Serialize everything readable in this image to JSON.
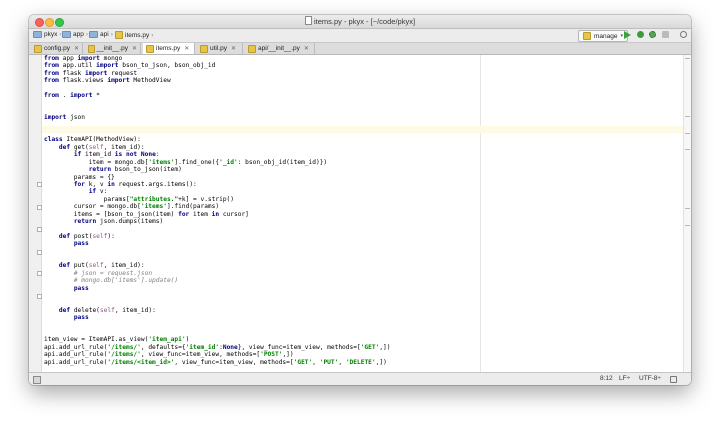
{
  "window": {
    "title": "items.py - pkyx - [~/code/pkyx]"
  },
  "breadcrumb": [
    "pkyx",
    "app",
    "api",
    "items.py"
  ],
  "toolbar": {
    "run_config": "manage"
  },
  "tabs": [
    {
      "label": "config.py",
      "active": false
    },
    {
      "label": "__init__.py",
      "active": false
    },
    {
      "label": "items.py",
      "active": true
    },
    {
      "label": "util.py",
      "active": false
    },
    {
      "label": "api/__init__.py",
      "active": false
    }
  ],
  "editor": {
    "lines": [
      "from app import mongo",
      "from app.util import bson_to_json, bson_obj_id",
      "from flask import request",
      "from flask.views import MethodView",
      "",
      "from . import *",
      "",
      "",
      "import json",
      "",
      "",
      "class ItemAPI(MethodView):",
      "    def get(self, item_id):",
      "        if item_id is not None:",
      "            item = mongo.db['items'].find_one({'_id': bson_obj_id(item_id)})",
      "            return bson_to_json(item)",
      "        params = {}",
      "        for k, v in request.args.items():",
      "            if v:",
      "                params[\"attributes.\"+k] = v.strip()",
      "        cursor = mongo.db['items'].find(params)",
      "        items = [bson_to_json(item) for item in cursor]",
      "        return json.dumps(items)",
      "",
      "    def post(self):",
      "        pass",
      "",
      "",
      "    def put(self, item_id):",
      "        # json = request.json",
      "        # mongo.db['items'].update()",
      "        pass",
      "",
      "",
      "    def delete(self, item_id):",
      "        pass",
      "",
      "",
      "item_view = ItemAPI.as_view('item_api')",
      "api.add_url_rule('/items/', defaults={'item_id':None}, view_func=item_view, methods=['GET',])",
      "api.add_url_rule('/items/', view_func=item_view, methods=['POST',])",
      "api.add_url_rule('/items/<item_id>', view_func=item_view, methods=['GET', 'PUT', 'DELETE',])"
    ]
  },
  "status": {
    "position": "8:12",
    "line_sep": "LF÷",
    "encoding": "UTF-8÷"
  }
}
